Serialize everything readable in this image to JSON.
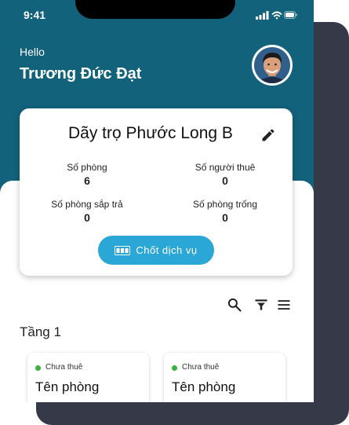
{
  "status_bar": {
    "time": "9:41"
  },
  "header": {
    "greeting": "Hello",
    "user_name": "Trương Đức Đạt"
  },
  "property": {
    "name": "Dãy trọ Phước Long B",
    "stats": {
      "rooms_label": "Số phòng",
      "rooms_value": "6",
      "tenants_label": "Số người thuê",
      "tenants_value": "0",
      "ending_label": "Số phòng sắp trả",
      "ending_value": "0",
      "vacant_label": "Số phòng trống",
      "vacant_value": "0"
    },
    "close_service_label": "Chốt dịch vụ"
  },
  "floor": {
    "title": "Tầng 1"
  },
  "rooms": [
    {
      "status": "Chưa thuê",
      "name": "Tên phòng"
    },
    {
      "status": "Chưa thuê",
      "name": "Tên phòng"
    }
  ],
  "icons": [
    "signal-icon",
    "wifi-icon",
    "battery-icon",
    "edit-icon",
    "meter-icon",
    "search-icon",
    "filter-icon",
    "menu-icon"
  ],
  "colors": {
    "header": "#12627c",
    "accent_button": "#2aa7d6",
    "status_dot": "#3cb043",
    "back_panel": "#363947"
  }
}
